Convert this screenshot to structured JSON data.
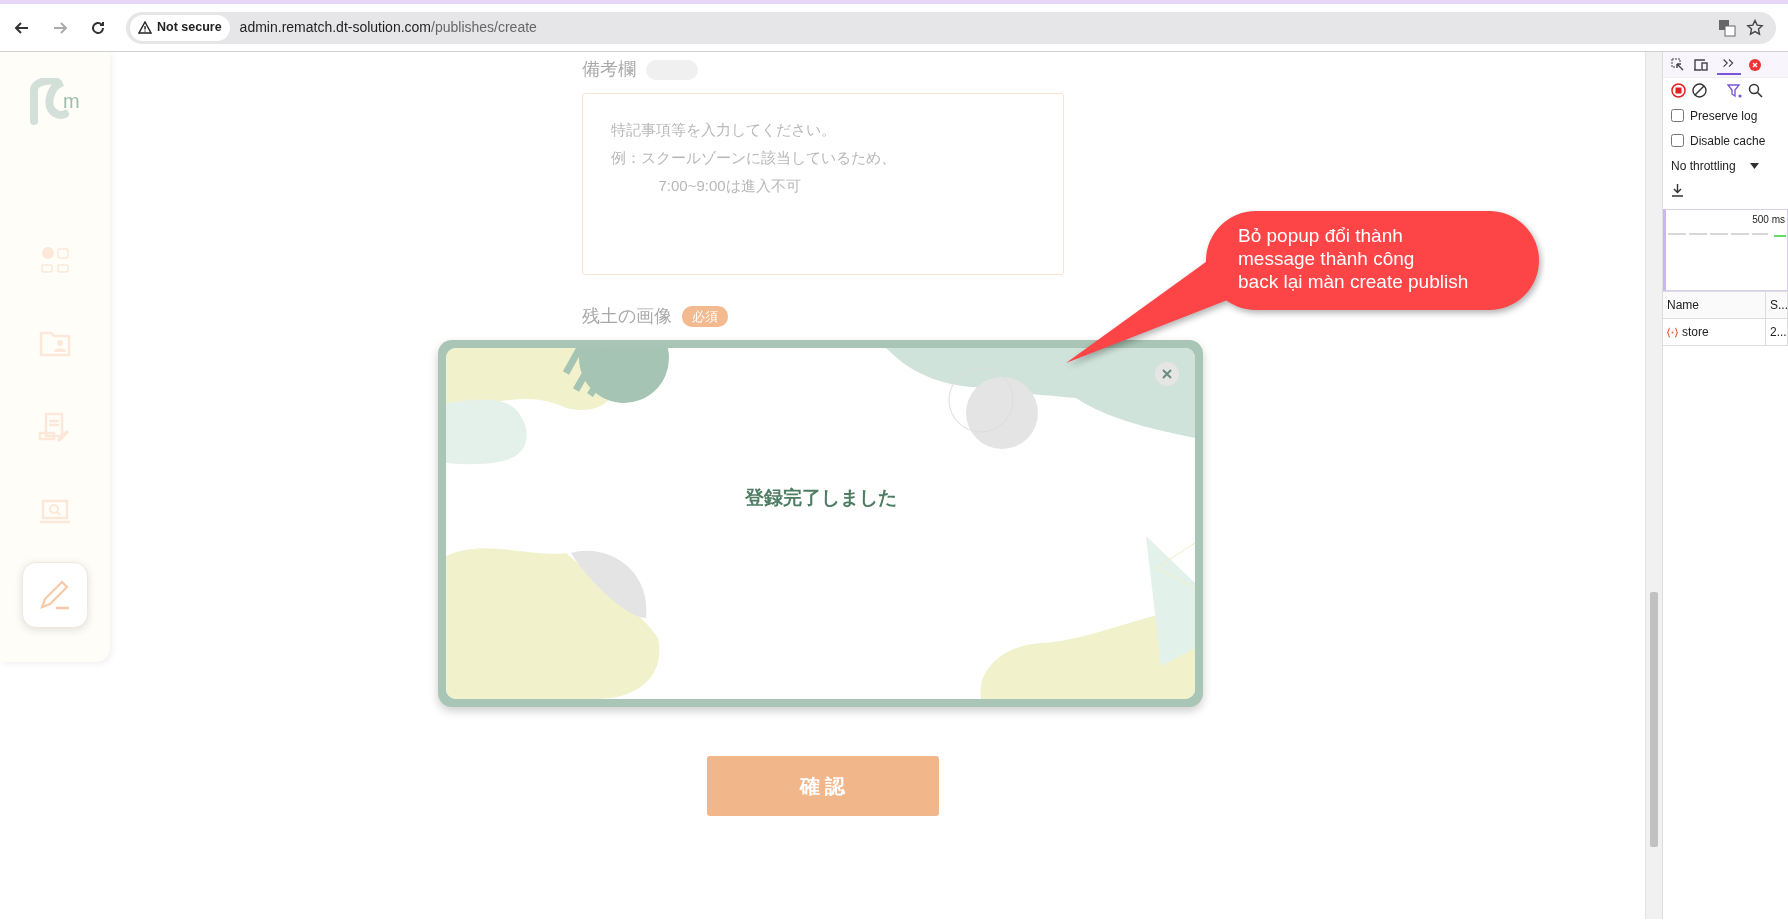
{
  "browser": {
    "security": "Not secure",
    "url_host": "admin.rematch.dt-solution.com",
    "url_path": "/publishes/create"
  },
  "sidebar": {
    "logo_text": "m",
    "items": [
      {
        "selected": false
      },
      {
        "selected": false
      },
      {
        "selected": false
      },
      {
        "selected": false
      },
      {
        "selected": true
      }
    ]
  },
  "form": {
    "remarks_label": "備考欄",
    "remarks_placeholder_lines": [
      "特記事項等を入力してください。",
      "例：スクールゾーンに該当しているため、",
      "7:00~9:00は進入不可"
    ],
    "image_label": "残土の画像",
    "image_badge": "必須",
    "confirm_button": "確 認"
  },
  "dialog": {
    "message": "登録完了しました"
  },
  "callout": {
    "lines": [
      "Bỏ popup đổi thành",
      "message thành công",
      "back lại màn create publish"
    ]
  },
  "devtools": {
    "checkboxes": [
      {
        "label": "Preserve log",
        "checked": false
      },
      {
        "label": "Disable cache",
        "checked": false
      }
    ],
    "throttling": "No throttling",
    "timeline_label": "500 ms",
    "columns": [
      "Name",
      "S..."
    ],
    "rows": [
      {
        "name": "store",
        "status": "2..."
      }
    ]
  }
}
